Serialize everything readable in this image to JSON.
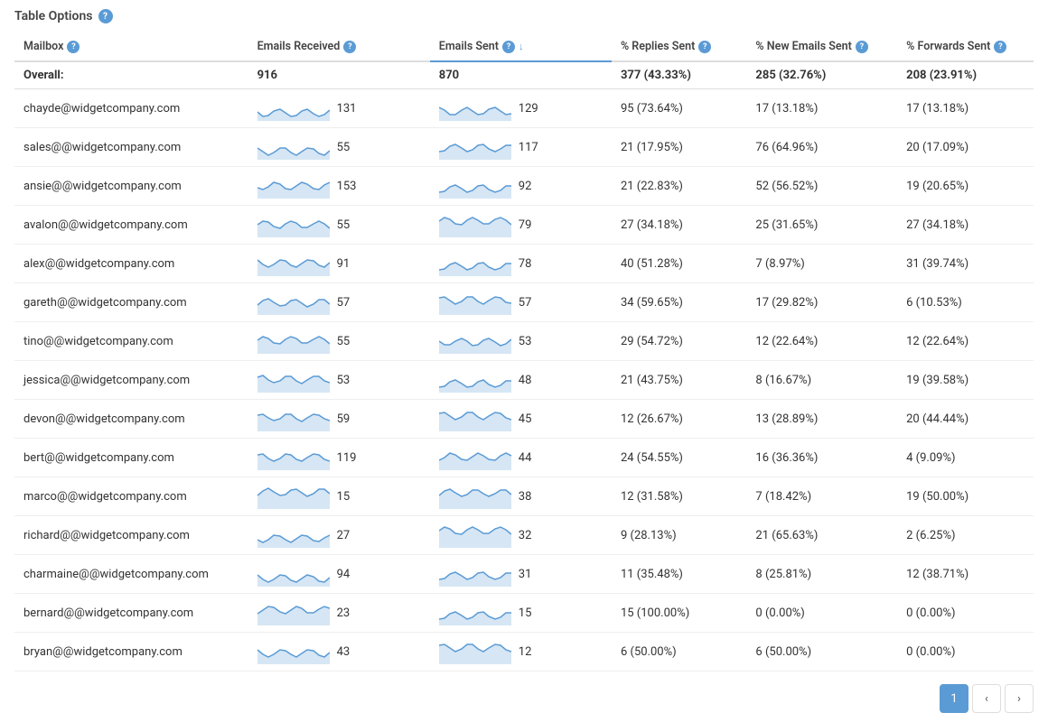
{
  "header": {
    "title": "Table Options",
    "icon": "?"
  },
  "columns": [
    {
      "id": "mailbox",
      "label": "Mailbox",
      "hasInfo": true,
      "sorted": false
    },
    {
      "id": "received",
      "label": "Emails Received",
      "hasInfo": true,
      "sorted": false
    },
    {
      "id": "sent",
      "label": "Emails Sent",
      "hasInfo": true,
      "sorted": true,
      "sortDir": "desc"
    },
    {
      "id": "replies",
      "label": "% Replies Sent",
      "hasInfo": true,
      "sorted": false
    },
    {
      "id": "new",
      "label": "% New Emails Sent",
      "hasInfo": true,
      "sorted": false
    },
    {
      "id": "forwards",
      "label": "% Forwards Sent",
      "hasInfo": true,
      "sorted": false
    }
  ],
  "overall": {
    "label": "Overall:",
    "received": "916",
    "sent": "870",
    "replies": "377 (43.33%)",
    "new": "285 (32.76%)",
    "forwards": "208 (23.91%)"
  },
  "rows": [
    {
      "mailbox": "chayde@widgetcompany.com",
      "received": 131,
      "sent": 129,
      "replies": "95 (73.64%)",
      "new": "17 (13.18%)",
      "forwards": "17 (13.18%)"
    },
    {
      "mailbox": "sales@@widgetcompany.com",
      "received": 55,
      "sent": 117,
      "replies": "21 (17.95%)",
      "new": "76 (64.96%)",
      "forwards": "20 (17.09%)"
    },
    {
      "mailbox": "ansie@@widgetcompany.com",
      "received": 153,
      "sent": 92,
      "replies": "21 (22.83%)",
      "new": "52 (56.52%)",
      "forwards": "19 (20.65%)"
    },
    {
      "mailbox": "avalon@@widgetcompany.com",
      "received": 55,
      "sent": 79,
      "replies": "27 (34.18%)",
      "new": "25 (31.65%)",
      "forwards": "27 (34.18%)"
    },
    {
      "mailbox": "alex@@widgetcompany.com",
      "received": 91,
      "sent": 78,
      "replies": "40 (51.28%)",
      "new": "7 (8.97%)",
      "forwards": "31 (39.74%)"
    },
    {
      "mailbox": "gareth@@widgetcompany.com",
      "received": 57,
      "sent": 57,
      "replies": "34 (59.65%)",
      "new": "17 (29.82%)",
      "forwards": "6 (10.53%)"
    },
    {
      "mailbox": "tino@@widgetcompany.com",
      "received": 55,
      "sent": 53,
      "replies": "29 (54.72%)",
      "new": "12 (22.64%)",
      "forwards": "12 (22.64%)"
    },
    {
      "mailbox": "jessica@@widgetcompany.com",
      "received": 53,
      "sent": 48,
      "replies": "21 (43.75%)",
      "new": "8 (16.67%)",
      "forwards": "19 (39.58%)"
    },
    {
      "mailbox": "devon@@widgetcompany.com",
      "received": 59,
      "sent": 45,
      "replies": "12 (26.67%)",
      "new": "13 (28.89%)",
      "forwards": "20 (44.44%)"
    },
    {
      "mailbox": "bert@@widgetcompany.com",
      "received": 119,
      "sent": 44,
      "replies": "24 (54.55%)",
      "new": "16 (36.36%)",
      "forwards": "4 (9.09%)"
    },
    {
      "mailbox": "marco@@widgetcompany.com",
      "received": 15,
      "sent": 38,
      "replies": "12 (31.58%)",
      "new": "7 (18.42%)",
      "forwards": "19 (50.00%)"
    },
    {
      "mailbox": "richard@@widgetcompany.com",
      "received": 27,
      "sent": 32,
      "replies": "9 (28.13%)",
      "new": "21 (65.63%)",
      "forwards": "2 (6.25%)"
    },
    {
      "mailbox": "charmaine@@widgetcompany.com",
      "received": 94,
      "sent": 31,
      "replies": "11 (35.48%)",
      "new": "8 (25.81%)",
      "forwards": "12 (38.71%)"
    },
    {
      "mailbox": "bernard@@widgetcompany.com",
      "received": 23,
      "sent": 15,
      "replies": "15 (100.00%)",
      "new": "0 (0.00%)",
      "forwards": "0 (0.00%)"
    },
    {
      "mailbox": "bryan@@widgetcompany.com",
      "received": 43,
      "sent": 12,
      "replies": "6 (50.00%)",
      "new": "6 (50.00%)",
      "forwards": "0 (0.00%)"
    }
  ],
  "pagination": {
    "current": 1,
    "prev_label": "‹",
    "next_label": "›"
  }
}
